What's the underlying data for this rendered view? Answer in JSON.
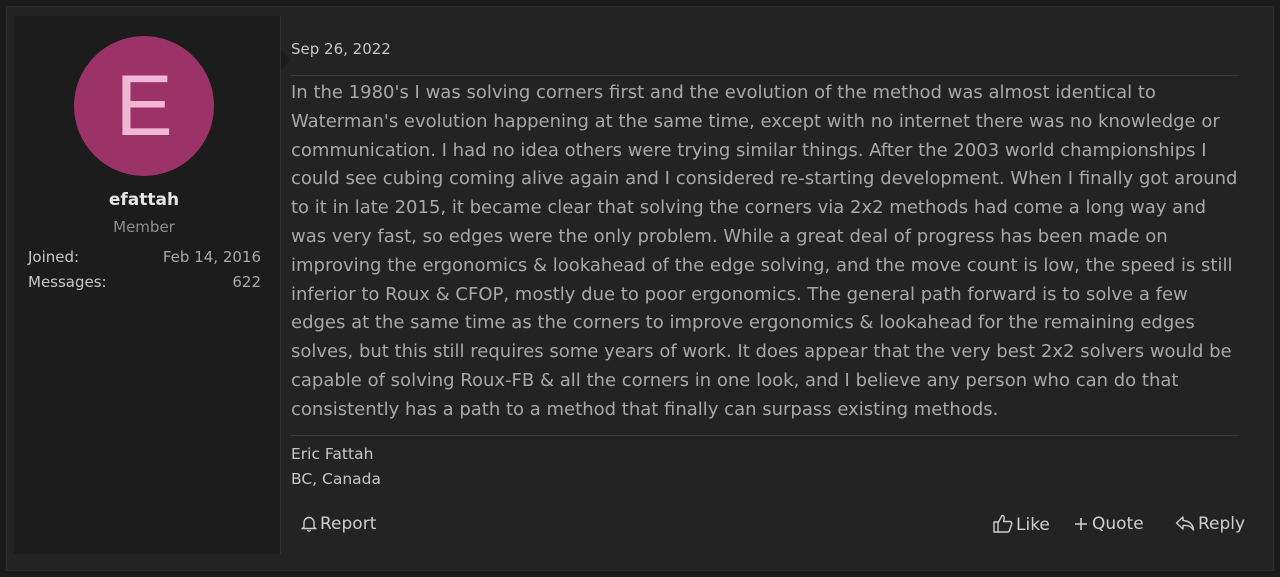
{
  "post": {
    "date": "Sep 26, 2022",
    "body": "In the 1980's I was solving corners first and the evolution of the method was almost identical to Waterman's evolution happening at the same time, except with no internet there was no knowledge or communication. I had no idea others were trying similar things. After the 2003 world championships I could see cubing coming alive again and I considered re-starting development. When I finally got around to it in late 2015, it became clear that solving the corners via 2x2 methods had come a long way and was very fast, so edges were the only problem. While a great deal of progress has been made on improving the ergonomics & lookahead of the edge solving, and the move count is low, the speed is still inferior to Roux & CFOP, mostly due to poor ergonomics. The general path forward is to solve a few edges at the same time as the corners to improve ergonomics & lookahead for the remaining edges solves, but this still requires some years of work. It does appear that the very best 2x2 solvers would be capable of solving Roux-FB & all the corners in one look, and I believe any person who can do that consistently has a path to a method that finally can surpass existing methods.",
    "signature": [
      "Eric Fattah",
      "BC, Canada"
    ]
  },
  "user": {
    "avatar_letter": "E",
    "avatar_color": "#9c3368",
    "username": "efattah",
    "title": "Member",
    "stats": [
      {
        "label": "Joined:",
        "value": "Feb 14, 2016"
      },
      {
        "label": "Messages:",
        "value": "622"
      }
    ]
  },
  "actions": {
    "report": {
      "label": "Report",
      "icon": "bell-icon"
    },
    "like": {
      "label": "Like",
      "icon": "thumbs-up-icon"
    },
    "quote": {
      "label": "Quote",
      "icon": "plus-icon"
    },
    "reply": {
      "label": "Reply",
      "icon": "reply-icon"
    }
  }
}
